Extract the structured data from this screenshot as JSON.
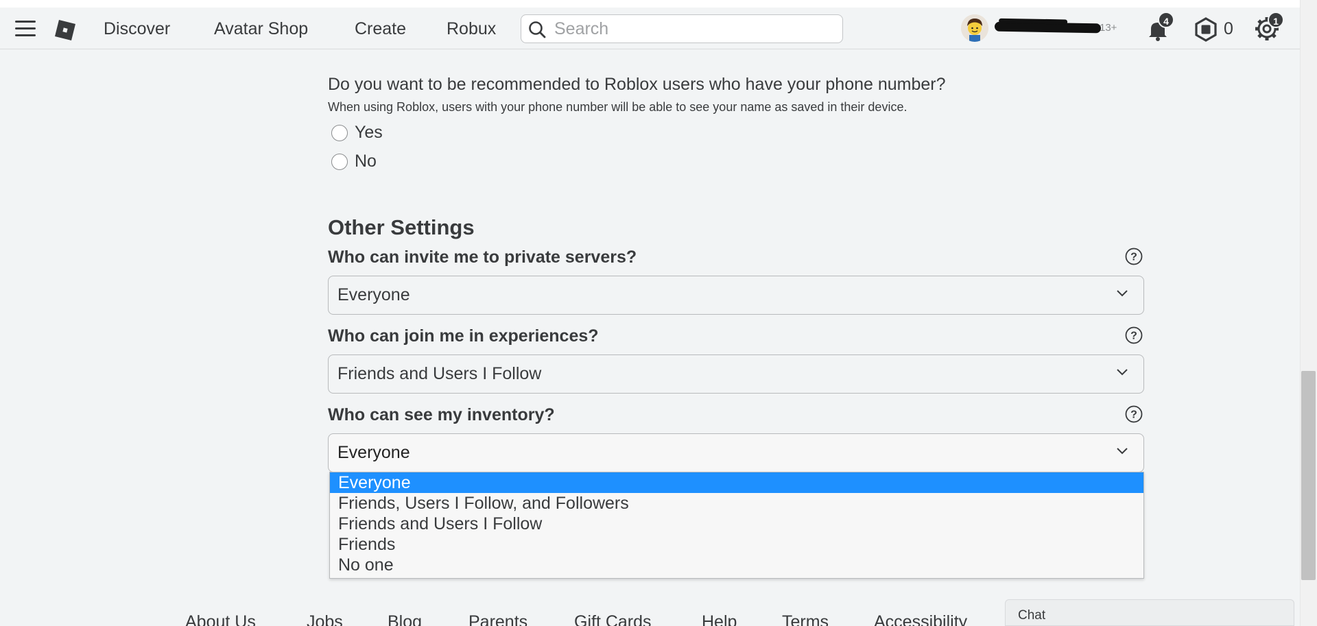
{
  "header": {
    "nav": [
      "Discover",
      "Avatar Shop",
      "Create",
      "Robux"
    ],
    "search_placeholder": "Search",
    "age_label": "13+",
    "notifications_count": "4",
    "robux_balance": "0",
    "settings_badge": "1",
    "icons": [
      "hamburger-icon",
      "roblox-logo",
      "search-icon",
      "bell-icon",
      "robux-icon",
      "gear-icon"
    ]
  },
  "phone_section": {
    "question": "Do you want to be recommended to Roblox users who have your phone number?",
    "description": "When using Roblox, users with your phone number will be able to see your name as saved in their device.",
    "options": [
      "Yes",
      "No"
    ]
  },
  "other_settings": {
    "title": "Other Settings",
    "settings": [
      {
        "label": "Who can invite me to private servers?",
        "value": "Everyone"
      },
      {
        "label": "Who can join me in experiences?",
        "value": "Friends and Users I Follow"
      },
      {
        "label": "Who can see my inventory?",
        "value": "Everyone"
      }
    ],
    "inventory_options": [
      "Everyone",
      "Friends, Users I Follow, and Followers",
      "Friends and Users I Follow",
      "Friends",
      "No one"
    ],
    "inventory_selected_index": 0
  },
  "footer": {
    "links": [
      "About Us",
      "Jobs",
      "Blog",
      "Parents",
      "Gift Cards",
      "Help",
      "Terms",
      "Accessibility"
    ],
    "chat_label": "Chat"
  },
  "colors": {
    "background": "#f2f4f5",
    "text": "#393b3d",
    "dropdown_highlight": "#1e90ff"
  }
}
